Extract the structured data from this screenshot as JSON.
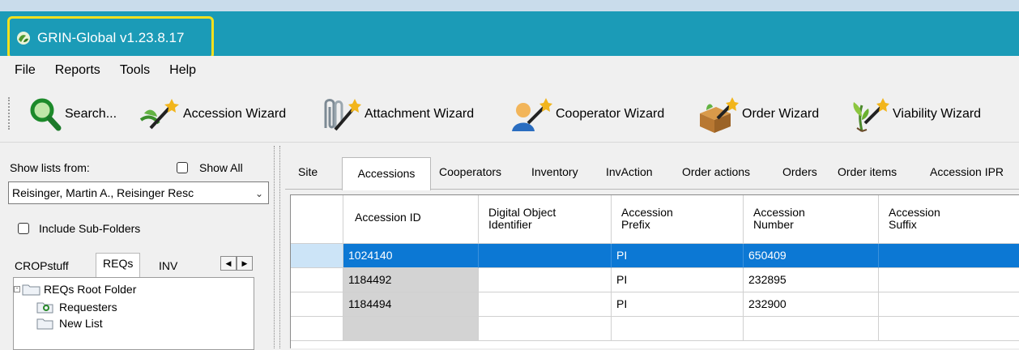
{
  "app": {
    "title": "GRIN-Global v1.23.8.17"
  },
  "menu": {
    "items": [
      "File",
      "Reports",
      "Tools",
      "Help"
    ]
  },
  "toolbar": {
    "search": "Search...",
    "accession_wizard": "Accession Wizard",
    "attachment_wizard": "Attachment Wizard",
    "cooperator_wizard": "Cooperator Wizard",
    "order_wizard": "Order Wizard",
    "viability_wizard": "Viability Wizard"
  },
  "left": {
    "show_lists_label": "Show lists from:",
    "show_all_label": "Show All",
    "owner_value": "Reisinger, Martin A., Reisinger Resc",
    "include_subfolders_label": "Include Sub-Folders",
    "tabs": [
      "CROPstuff",
      "REQs",
      "INV"
    ],
    "tree": [
      "REQs Root Folder",
      "Requesters",
      "New List"
    ]
  },
  "tabs": [
    "Site",
    "Accessions",
    "Cooperators",
    "Inventory",
    "InvAction",
    "Order actions",
    "Orders",
    "Order items",
    "Accession IPR"
  ],
  "grid": {
    "columns": [
      [
        "Accession ID"
      ],
      [
        "Digital Object",
        "Identifier"
      ],
      [
        "Accession",
        "Prefix"
      ],
      [
        "Accession",
        "Number"
      ],
      [
        "Accession",
        "Suffix"
      ]
    ],
    "rows": [
      {
        "id": "1024140",
        "doi": "",
        "prefix": "PI",
        "number": "650409",
        "suffix": ""
      },
      {
        "id": "1184492",
        "doi": "",
        "prefix": "PI",
        "number": "232895",
        "suffix": ""
      },
      {
        "id": "1184494",
        "doi": "",
        "prefix": "PI",
        "number": "232900",
        "suffix": ""
      }
    ]
  },
  "colors": {
    "titlebar": "#1b9bb7",
    "highlight": "#f4e01e",
    "selection": "#0c78d4"
  }
}
